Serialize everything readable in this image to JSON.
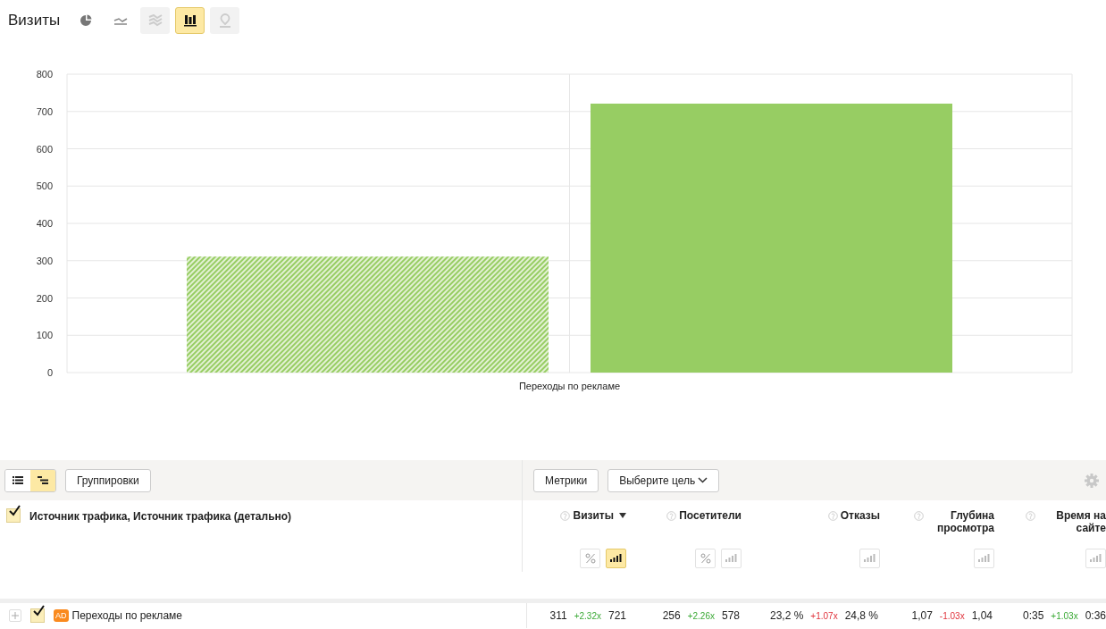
{
  "title": "Визиты",
  "chart_types": [
    {
      "kind": "pie",
      "selected": false,
      "disabled": false
    },
    {
      "kind": "line",
      "selected": false,
      "disabled": false
    },
    {
      "kind": "area",
      "selected": false,
      "disabled": true
    },
    {
      "kind": "bar",
      "selected": true,
      "disabled": false
    },
    {
      "kind": "map",
      "selected": false,
      "disabled": true
    }
  ],
  "chart": {
    "chart_data": {
      "type": "bar",
      "categories": [
        "Переходы по рекламе"
      ],
      "ylim": [
        0,
        800
      ],
      "yticks": [
        0,
        100,
        200,
        300,
        400,
        500,
        600,
        700,
        800
      ],
      "grid": true,
      "series": [
        {
          "color": "#97cd63",
          "values": [
            311
          ]
        },
        {
          "color": "#97cd63",
          "values": [
            721
          ]
        }
      ]
    }
  },
  "toolbar": {
    "views": [
      {
        "kind": "list",
        "selected": false
      },
      {
        "kind": "tree",
        "selected": true
      }
    ],
    "groupings_button": "Группировки",
    "metrics_button": "Метрики",
    "goal_select": "Выберите цель"
  },
  "grouping": {
    "checked": true,
    "label": "Источник трафика, Источник трафика (детально)"
  },
  "metrics": [
    {
      "name": "Визиты",
      "sorted": true,
      "toggles": [
        {
          "kind": "percent",
          "selected": false
        },
        {
          "kind": "chart",
          "selected": true
        }
      ]
    },
    {
      "name": "Посетители",
      "sorted": false,
      "toggles": [
        {
          "kind": "percent",
          "selected": false
        },
        {
          "kind": "chart",
          "selected": false
        }
      ]
    },
    {
      "name": "Отказы",
      "sorted": false,
      "toggles": [
        {
          "kind": "chart",
          "selected": false
        }
      ]
    },
    {
      "name": "Глубина просмотра",
      "sorted": false,
      "toggles": [
        {
          "kind": "chart",
          "selected": false
        }
      ]
    },
    {
      "name": "Время на сайте",
      "sorted": false,
      "toggles": [
        {
          "kind": "chart",
          "selected": false
        }
      ]
    }
  ],
  "rows": [
    {
      "label": "Переходы по рекламе",
      "badge": "AD",
      "checked": true,
      "expanded": false,
      "cells": [
        {
          "value": "311",
          "delta": "+2.32x",
          "delta_positive": true,
          "compare": "721"
        },
        {
          "value": "256",
          "delta": "+2.26x",
          "delta_positive": true,
          "compare": "578"
        },
        {
          "value": "23,2 %",
          "delta": "+1.07x",
          "delta_positive": false,
          "compare": "24,8 %"
        },
        {
          "value": "1,07",
          "delta": "-1.03x",
          "delta_positive": false,
          "compare": "1,04"
        },
        {
          "value": "0:35",
          "delta": "+1.03x",
          "delta_positive": true,
          "compare": "0:36"
        }
      ]
    }
  ]
}
